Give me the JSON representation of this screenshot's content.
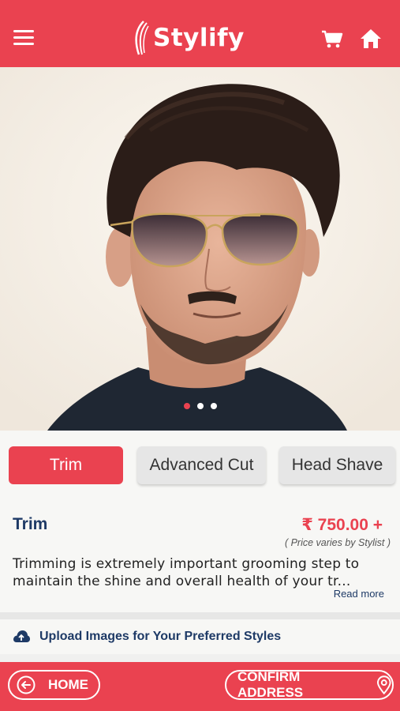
{
  "app": {
    "brand_name": "Stylify",
    "accent_color": "#ea4250",
    "icons": [
      "menu-icon",
      "cart-icon",
      "home-icon"
    ]
  },
  "carousel": {
    "slide_count": 3,
    "active_index": 0
  },
  "services": {
    "tabs": [
      {
        "label": "Trim",
        "active": true
      },
      {
        "label": "Advanced Cut",
        "active": false
      },
      {
        "label": "Head Shave",
        "active": false
      }
    ]
  },
  "details": {
    "name": "Trim",
    "price": "₹ 750.00 +",
    "price_note": "( Price varies by Stylist )",
    "description": "Trimming is extremely important grooming step to maintain the shine and overall health of your tr...",
    "read_more": "Read more"
  },
  "upload": {
    "label": "Upload Images for Your Preferred Styles"
  },
  "bottom_bar": {
    "home_label": "HOME",
    "confirm_label": "CONFIRM ADDRESS"
  }
}
